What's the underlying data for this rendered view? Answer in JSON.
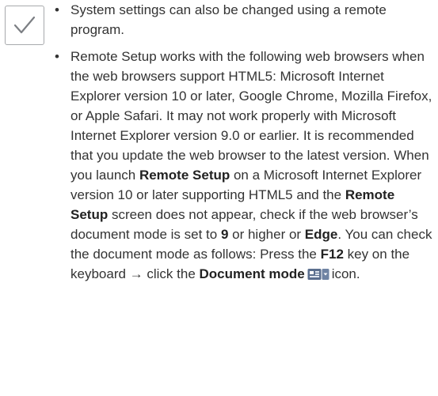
{
  "note_icon": "checkmark-icon",
  "bullets": {
    "item1": {
      "text": "System settings can also be changed using a remote program."
    },
    "item2": {
      "t1": "Remote Setup works with the following web browsers when the web browsers support HTML5: Microsoft Internet Explorer version 10 or later, Google Chrome, Mozilla Firefox, or Apple Safari. It may not work properly with Microsoft Internet Explorer version 9.0 or earlier.  It is recommended that you update the web browser to the latest version. When you launch ",
      "b1": "Remote Setup",
      "t2": " on a Microsoft Internet Explorer version 10 or later supporting HTML5 and the ",
      "b2": "Remote Setup",
      "t3": " screen does not appear, check if the web browser’s document mode is set to ",
      "b3": "9",
      "t4": " or higher or ",
      "b4": "Edge",
      "t5": ". You can check the document mode as follows: Press the ",
      "b5": "F12",
      "t6": " key on the keyboard → click the ",
      "b6": "Document mode",
      "t7": "icon.",
      "icon": "document-mode-icon"
    }
  },
  "colors": {
    "text": "#333333",
    "icon_border": "#a7a9ac",
    "check": "#7c7f84",
    "doc_icon": "#5b6f8f"
  }
}
